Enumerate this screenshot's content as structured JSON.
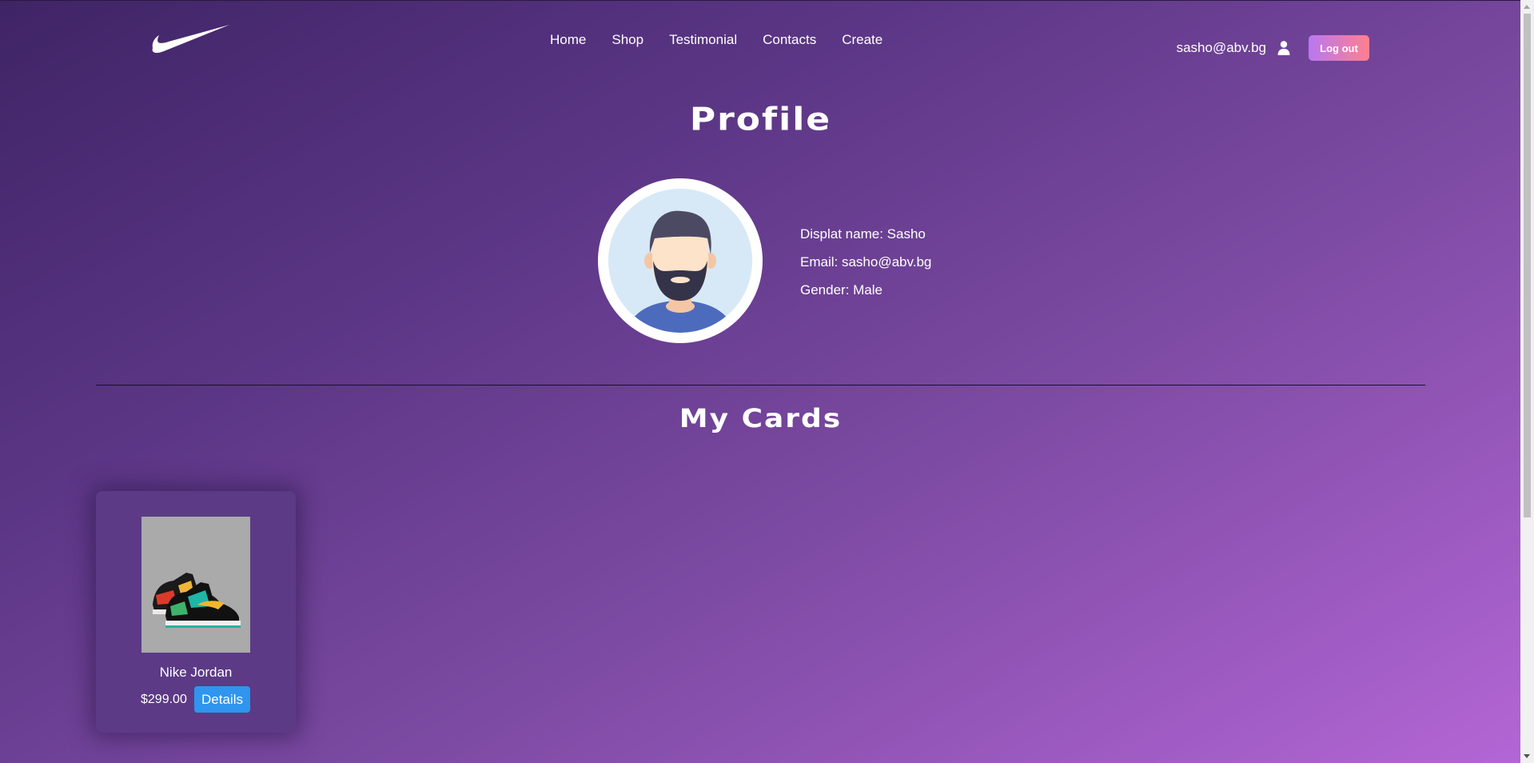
{
  "nav": {
    "items": [
      {
        "label": "Home"
      },
      {
        "label": "Shop"
      },
      {
        "label": "Testimonial"
      },
      {
        "label": "Contacts"
      },
      {
        "label": "Create"
      }
    ]
  },
  "user": {
    "email": "sasho@abv.bg",
    "logout_label": "Log out"
  },
  "profile": {
    "title": "Profile",
    "display_name": "Displat name: Sasho",
    "email": "Email: sasho@abv.bg",
    "gender": "Gender: Male"
  },
  "cards": {
    "title": "My Cards",
    "items": [
      {
        "name": "Nike Jordan",
        "price": "$299.00",
        "details_label": "Details"
      }
    ]
  },
  "colors": {
    "accent_button": "#2f95ee",
    "logout_gradient_start": "#b978f0",
    "logout_gradient_end": "#ff7f8f"
  },
  "icons": [
    "nike-swoosh-logo",
    "user-icon"
  ]
}
